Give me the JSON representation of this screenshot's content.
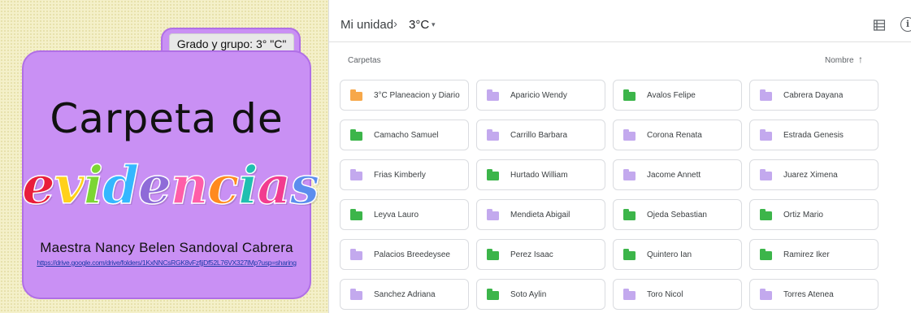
{
  "cover": {
    "tab_label": "Grado y grupo: 3° \"C\"",
    "title": "Carpeta de",
    "word_letters": [
      {
        "char": "e",
        "color": "#e91e3b"
      },
      {
        "char": "v",
        "color": "#ffd11a"
      },
      {
        "char": "i",
        "color": "#7cd633"
      },
      {
        "char": "d",
        "color": "#34b7ff"
      },
      {
        "char": "e",
        "color": "#8e6bd8"
      },
      {
        "char": "n",
        "color": "#ff5ea8"
      },
      {
        "char": "c",
        "color": "#ff8a1f"
      },
      {
        "char": "i",
        "color": "#1fbfb0"
      },
      {
        "char": "a",
        "color": "#f23c8f"
      },
      {
        "char": "s",
        "color": "#5b8dee"
      }
    ],
    "teacher": "Maestra Nancy Belen Sandoval Cabrera",
    "link": "https://drive.google.com/drive/folders/1KxNNCsRGK8vFzfjjDf52L76VX327lMp?usp=sharing"
  },
  "drive": {
    "breadcrumb": {
      "root": "Mi unidad",
      "separator": "›",
      "current": "3°C",
      "caret": "▾"
    },
    "section_label": "Carpetas",
    "sort": {
      "label": "Nombre",
      "arrow": "↑"
    },
    "view_icon": "list-view-icon",
    "info_icon": "info-icon",
    "folder_colors": {
      "orange": "#f7a84a",
      "purple": "#c3a9ee",
      "green": "#3cb54a"
    },
    "folders": [
      {
        "name": "3°C Planeacion y Diario",
        "color": "#f7a84a"
      },
      {
        "name": "Aparicio Wendy",
        "color": "#c3a9ee"
      },
      {
        "name": "Avalos Felipe",
        "color": "#3cb54a"
      },
      {
        "name": "Cabrera Dayana",
        "color": "#c3a9ee"
      },
      {
        "name": "Camacho Samuel",
        "color": "#3cb54a"
      },
      {
        "name": "Carrillo Barbara",
        "color": "#c3a9ee"
      },
      {
        "name": "Corona Renata",
        "color": "#c3a9ee"
      },
      {
        "name": "Estrada Genesis",
        "color": "#c3a9ee"
      },
      {
        "name": "Frias Kimberly",
        "color": "#c3a9ee"
      },
      {
        "name": "Hurtado William",
        "color": "#3cb54a"
      },
      {
        "name": "Jacome Annett",
        "color": "#c3a9ee"
      },
      {
        "name": "Juarez Ximena",
        "color": "#c3a9ee"
      },
      {
        "name": "Leyva Lauro",
        "color": "#3cb54a"
      },
      {
        "name": "Mendieta Abigail",
        "color": "#c3a9ee"
      },
      {
        "name": "Ojeda Sebastian",
        "color": "#3cb54a"
      },
      {
        "name": "Ortiz Mario",
        "color": "#3cb54a"
      },
      {
        "name": "Palacios Breedeysee",
        "color": "#c3a9ee"
      },
      {
        "name": "Perez Isaac",
        "color": "#3cb54a"
      },
      {
        "name": "Quintero Ian",
        "color": "#3cb54a"
      },
      {
        "name": "Ramirez Iker",
        "color": "#3cb54a"
      },
      {
        "name": "Sanchez Adriana",
        "color": "#c3a9ee"
      },
      {
        "name": "Soto Aylin",
        "color": "#3cb54a"
      },
      {
        "name": "Toro Nicol",
        "color": "#c3a9ee"
      },
      {
        "name": "Torres Atenea",
        "color": "#c3a9ee"
      }
    ]
  }
}
